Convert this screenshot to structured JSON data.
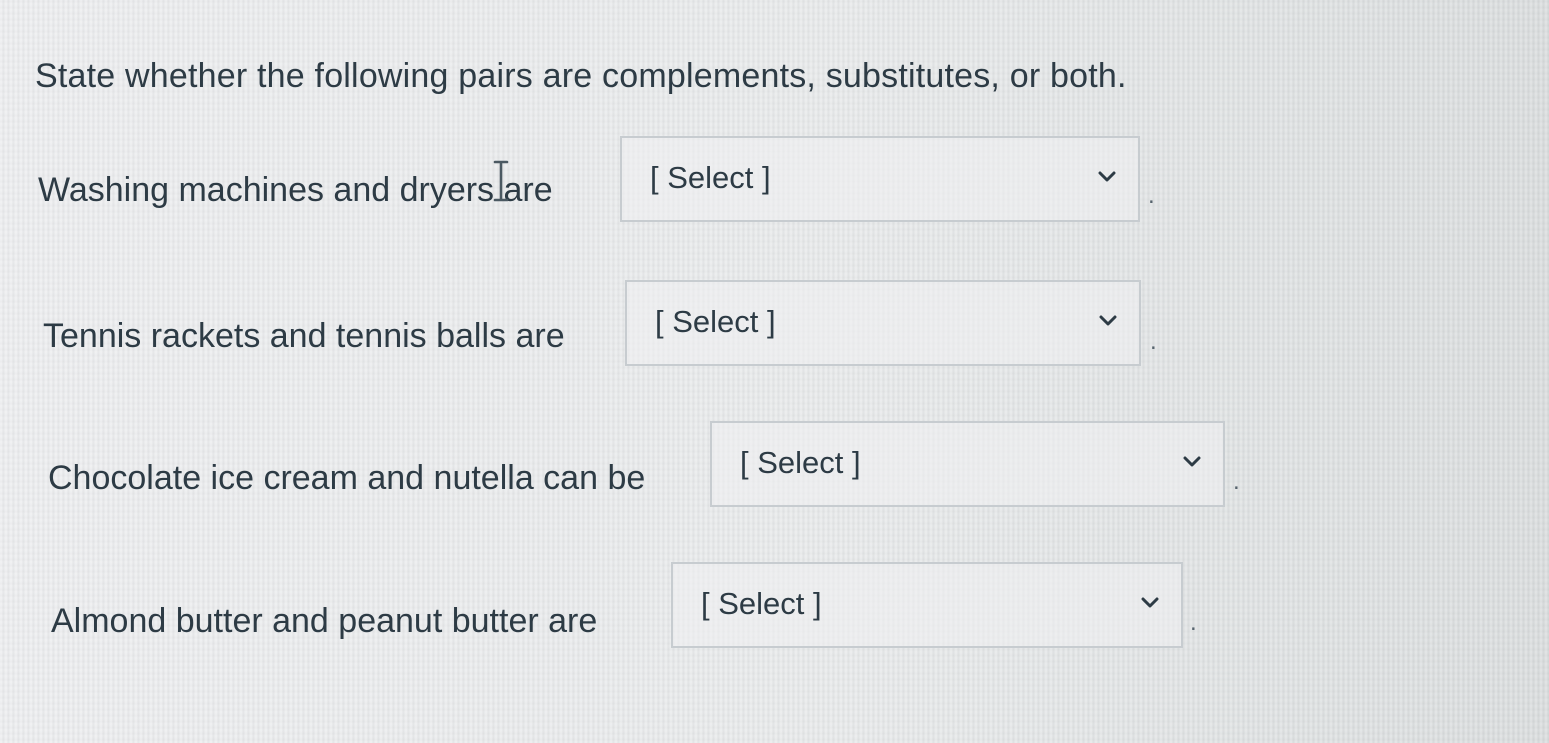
{
  "question": {
    "prompt": "State whether the following pairs are complements, substitutes, or both.",
    "rows": [
      {
        "label": "Washing machines and dryers are",
        "selected": "[ Select ]",
        "punctuation": "."
      },
      {
        "label": "Tennis rackets and tennis balls are",
        "selected": "[ Select ]",
        "punctuation": "."
      },
      {
        "label": "Chocolate ice cream and nutella can be",
        "selected": "[ Select ]",
        "punctuation": "."
      },
      {
        "label": "Almond butter and peanut butter are",
        "selected": "[ Select ]",
        "punctuation": "."
      }
    ]
  },
  "icons": {
    "dropdown": "chevron-down-icon",
    "cursor": "text-cursor-icon"
  },
  "colors": {
    "text": "#2d3b45",
    "border": "#c7ccd0",
    "background": "#e8eaeb"
  }
}
